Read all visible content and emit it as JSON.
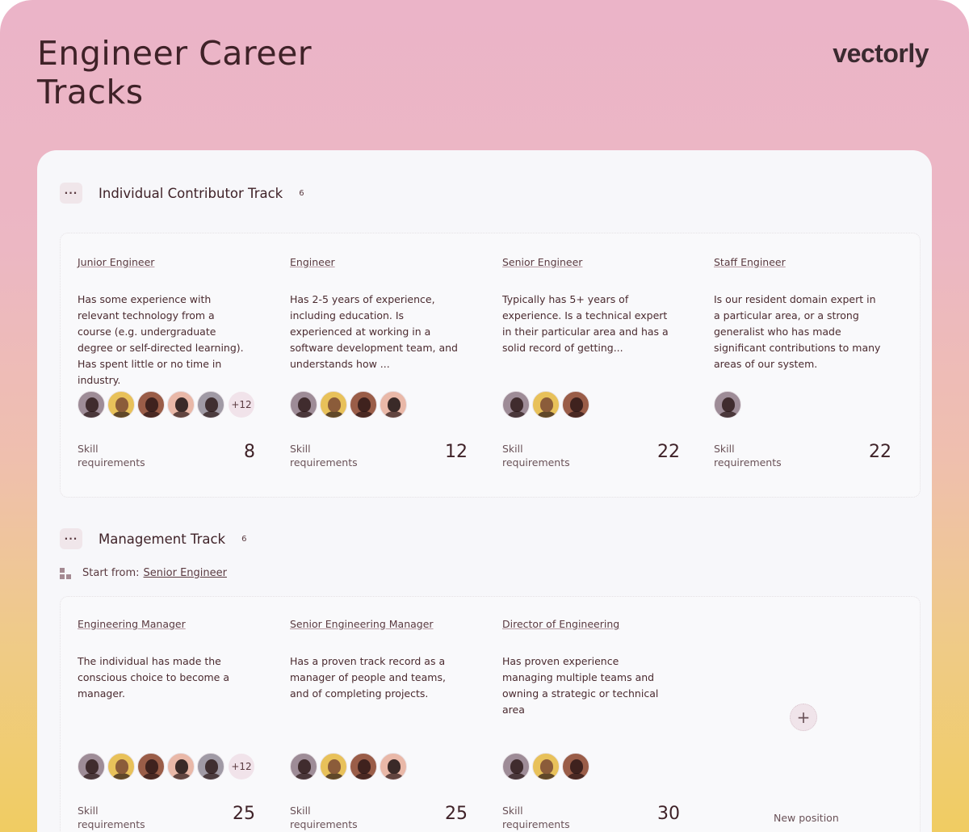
{
  "page": {
    "title": "Engineer Career Tracks",
    "logo": "vectorly"
  },
  "tracks": [
    {
      "name": "Individual Contributor Track",
      "count": "6",
      "positions": [
        {
          "title": "Junior Engineer",
          "description": "Has some experience with relevant technology from a course (e.g. undergraduate degree or self-directed learning). Has spent little or no time in industry.",
          "avatars": [
            "avatar-1",
            "avatar-2",
            "avatar-3",
            "avatar-4",
            "avatar-5"
          ],
          "more": "+12",
          "skill_label": "Skill requirements",
          "skill_count": "8"
        },
        {
          "title": "Engineer",
          "description": "Has 2-5 years of experience, including education. Is experienced at working in a software development team, and understands how ...",
          "avatars": [
            "avatar-1",
            "avatar-2",
            "avatar-3",
            "avatar-4"
          ],
          "more": "",
          "skill_label": "Skill requirements",
          "skill_count": "12"
        },
        {
          "title": "Senior Engineer",
          "description": "Typically has 5+ years of experience. Is a technical expert in their particular area and has a solid record of getting...",
          "avatars": [
            "avatar-1",
            "avatar-2",
            "avatar-3"
          ],
          "more": "",
          "skill_label": "Skill requirements",
          "skill_count": "22"
        },
        {
          "title": "Staff Engineer",
          "description": "Is our resident domain expert in a particular area, or a strong generalist who has made significant contributions to many areas of our system.",
          "avatars": [
            "avatar-1"
          ],
          "more": "",
          "skill_label": "Skill requirements",
          "skill_count": "22"
        }
      ]
    },
    {
      "name": "Management Track",
      "count": "6",
      "start_from_label": "Start from:",
      "start_from_value": "Senior Engineer",
      "positions": [
        {
          "title": "Engineering Manager",
          "description": "The individual has made the conscious choice to become a manager.",
          "avatars": [
            "avatar-1",
            "avatar-2",
            "avatar-3",
            "avatar-4",
            "avatar-5"
          ],
          "more": "+12",
          "skill_label": "Skill requirements",
          "skill_count": "25"
        },
        {
          "title": "Senior Engineering Manager",
          "description": "Has a proven track record as a manager of people and teams, and of completing projects.",
          "avatars": [
            "avatar-1",
            "avatar-2",
            "avatar-3",
            "avatar-4"
          ],
          "more": "",
          "skill_label": "Skill requirements",
          "skill_count": "25"
        },
        {
          "title": "Director of Engineering",
          "description": "Has proven experience managing multiple teams and owning a strategic or technical area",
          "avatars": [
            "avatar-1",
            "avatar-2",
            "avatar-3"
          ],
          "more": "",
          "skill_label": "Skill requirements",
          "skill_count": "30"
        }
      ],
      "new_position": {
        "icon": "plus-icon",
        "label": "New position"
      }
    }
  ]
}
